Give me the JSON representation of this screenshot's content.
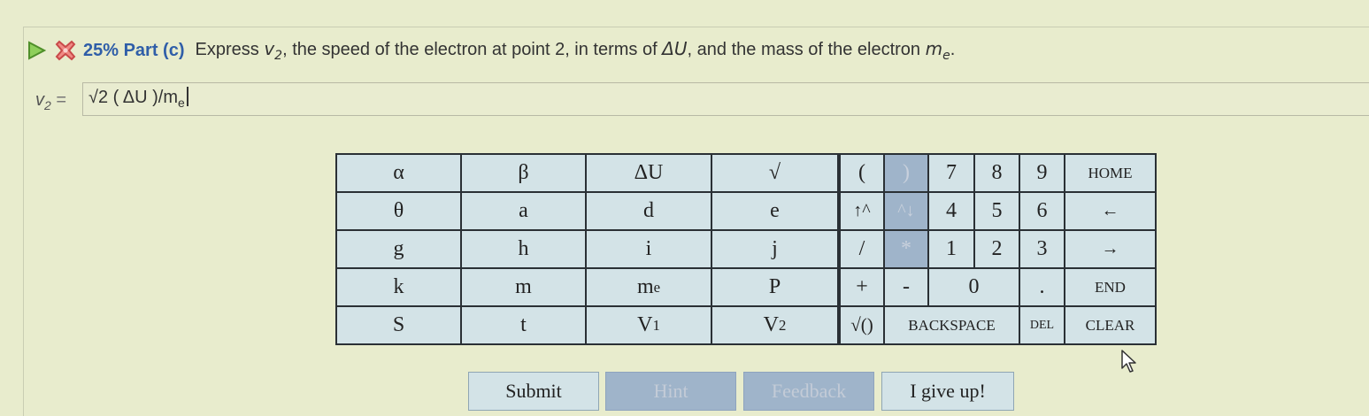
{
  "header": {
    "percent": "25%",
    "part": "Part (c)",
    "prompt_1": "Express ",
    "var_v": "v",
    "var_v_sub": "2",
    "prompt_2": ", the speed of the electron at point 2, in terms of ",
    "delta_u": "ΔU",
    "prompt_3": ", and the mass of the electron ",
    "var_m": "m",
    "var_m_sub": "e"
  },
  "answer": {
    "label_var": "v",
    "label_sub": "2",
    "label_eq": " =",
    "value_main": "√2 ( ΔU )/m",
    "value_sub": "e"
  },
  "keypad": {
    "alpha": "α",
    "beta": "β",
    "delta_u": "ΔU",
    "sqrt": "√",
    "theta": "θ",
    "a": "a",
    "d": "d",
    "e": "e",
    "g": "g",
    "h": "h",
    "i": "i",
    "j": "j",
    "k": "k",
    "m": "m",
    "me_base": "m",
    "me_sub": "e",
    "P": "P",
    "S": "S",
    "t": "t",
    "v1_base": "V",
    "v1_sub": "1",
    "v2_base": "V",
    "v2_sub": "2",
    "lparen": "(",
    "rparen": ")",
    "up_caret": "↑^",
    "caret_down": "^↓",
    "slash": "/",
    "star": "*",
    "plus": "+",
    "minus": "-",
    "sqrt_paren": "√()",
    "d7": "7",
    "d8": "8",
    "d9": "9",
    "d4": "4",
    "d5": "5",
    "d6": "6",
    "d1": "1",
    "d2": "2",
    "d3": "3",
    "d0": "0",
    "dot": ".",
    "home": "HOME",
    "left": "←",
    "right": "→",
    "end": "END",
    "backspace": "BACKSPACE",
    "del": "DEL",
    "clear": "CLEAR"
  },
  "buttons": {
    "submit": "Submit",
    "hint": "Hint",
    "feedback": "Feedback",
    "give_up": "I give up!"
  },
  "colors": {
    "page_bg": "#e8eccd",
    "key_bg": "#d3e3e7",
    "key_disabled_bg": "#9fb4ca",
    "accent_blue": "#2f5ea8",
    "error_red": "#d9534f",
    "play_green": "#5aa02c"
  },
  "icons": [
    "play-icon",
    "x-icon",
    "mouse-cursor-icon"
  ]
}
